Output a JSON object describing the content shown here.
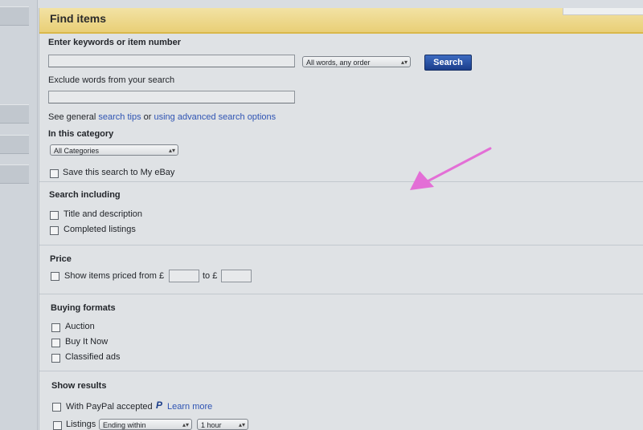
{
  "panel": {
    "title": "Find items"
  },
  "keywords": {
    "label": "Enter keywords or item number",
    "value": "",
    "match_select": "All words, any order",
    "search_button": "Search"
  },
  "exclude": {
    "label": "Exclude words from your search",
    "value": ""
  },
  "tips": {
    "prefix": "See general",
    "search_tips_link": "search tips",
    "middle": "or",
    "advanced_link": "using advanced search options"
  },
  "category": {
    "label": "In this category",
    "select": "All Categories"
  },
  "save_search": {
    "label": "Save this search to My eBay",
    "checked": false
  },
  "search_including": {
    "heading": "Search including",
    "options": [
      {
        "label": "Title and description",
        "checked": false
      },
      {
        "label": "Completed listings",
        "checked": false
      }
    ]
  },
  "price": {
    "heading": "Price",
    "show_label": "Show items priced from £",
    "to_label": "to £",
    "from_value": "",
    "to_value": ""
  },
  "buying_formats": {
    "heading": "Buying formats",
    "options": [
      {
        "label": "Auction",
        "checked": false
      },
      {
        "label": "Buy It Now",
        "checked": false
      },
      {
        "label": "Classified ads",
        "checked": false
      }
    ]
  },
  "show_results": {
    "heading": "Show results",
    "paypal_label": "With PayPal accepted",
    "paypal_icon": "paypal-icon",
    "paypal_glyph": "P",
    "learn_more": "Learn more",
    "listings_label": "Listings",
    "listings_select": "Ending within",
    "time_select": "1 hour"
  },
  "colors": {
    "header_gold": "#e9cf77",
    "button_blue": "#1a3d8a",
    "link_blue": "#2f54b3",
    "annotation_arrow": "#e36fd6"
  }
}
